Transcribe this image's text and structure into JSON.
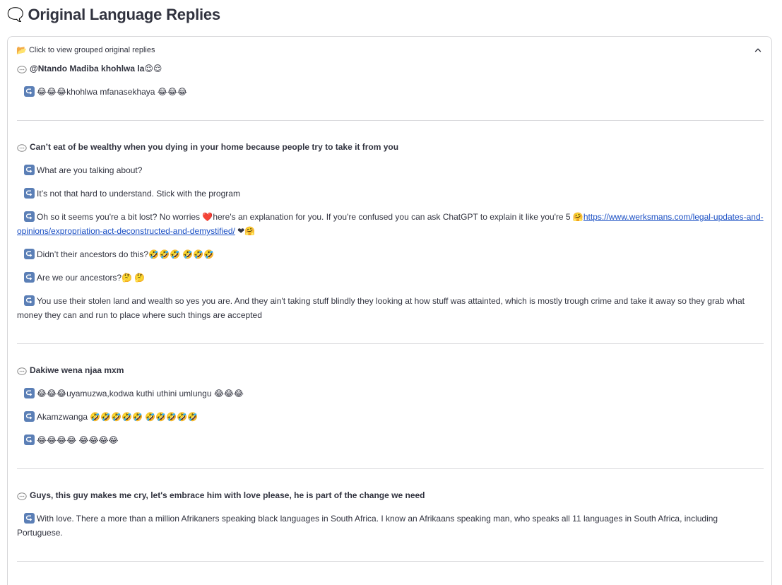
{
  "heading": {
    "icon": "speech-balloon-icon",
    "title": "Original Language Replies"
  },
  "expander": {
    "icon": "folder-icon",
    "label": "Click to view grouped original replies",
    "chevron": "chevron-up-icon"
  },
  "groups": [
    {
      "comment": "@Ntando Madiba khohlwa la😌😌",
      "replies": [
        {
          "text": "😂😂😂khohlwa mfanasekhaya  😂😂😂"
        }
      ]
    },
    {
      "comment": "Can’t eat of be wealthy when you dying in your home because people try to take it from you",
      "replies": [
        {
          "text": "What are you talking about?"
        },
        {
          "text": "It’s not that hard to understand. Stick with the program"
        },
        {
          "text": "Oh so it seems you're a bit lost? No worries ❤️here's an explanation for you. If you're confused you can ask ChatGPT to explain it like you're 5 🤗",
          "link": "https://www.werksmans.com/legal-updates-and-opinions/expropriation-act-deconstructed-and-demystified/",
          "after": " ❤🤗"
        },
        {
          "text": "Didn’t their ancestors do this?🤣🤣🤣  🤣🤣🤣"
        },
        {
          "text": "Are we our ancestors?🤔  🤔"
        },
        {
          "text": "You use their stolen land and wealth so yes you are. And they ain't taking stuff blindly they looking at how stuff was attainted, which is mostly trough crime and take it away so they grab what money they can and run to place where such things are accepted"
        }
      ]
    },
    {
      "comment": "Dakiwe wena njaa mxm",
      "replies": [
        {
          "text": "😂😂😂uyamuzwa,kodwa kuthi uthini umlungu  😂😂😂"
        },
        {
          "text": "Akamzwanga 🤣🤣🤣🤣🤣  🤣🤣🤣🤣🤣"
        },
        {
          "text": "😂😂😂😂  😂😂😂😂"
        }
      ]
    },
    {
      "comment": "Guys, this guy makes me cry, let's embrace him with love please, he is part of the change we need",
      "replies": [
        {
          "text": "With love. There a more than a million Afrikaners speaking black languages in South Africa. I know an Afrikaans speaking man, who speaks all 11 languages in South Africa, including Portuguese."
        }
      ]
    }
  ],
  "colors": {
    "text": "#31333f",
    "border": "#d6d6d9",
    "reply_icon": "#5b7fb6",
    "link": "#1a4fc4"
  }
}
